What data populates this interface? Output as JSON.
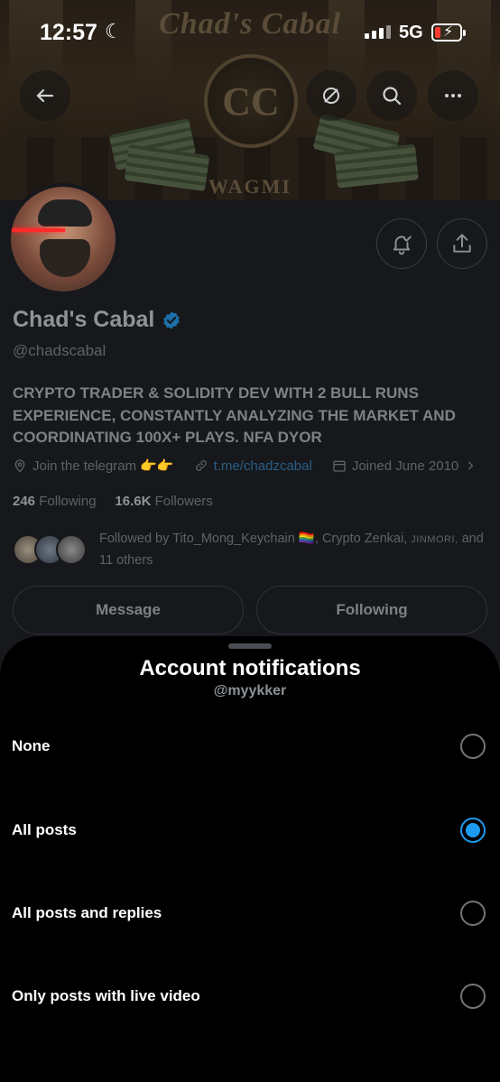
{
  "status_bar": {
    "time": "12:57",
    "network": "5G",
    "moon_icon": "moon-icon",
    "signal_icon": "cellular-signal-icon",
    "battery_icon": "battery-charging-low-icon",
    "battery_color": "#ff3b30"
  },
  "banner": {
    "title": "Chad's Cabal",
    "seal": "CC",
    "tagline": "WAGMI"
  },
  "top_actions": {
    "back_icon": "back-arrow-icon",
    "grok_icon": "slash-circle-icon",
    "search_icon": "search-icon",
    "more_icon": "more-horizontal-icon"
  },
  "profile": {
    "name": "Chad's Cabal",
    "handle": "@chadscabal",
    "verified_color": "#1d9bf0",
    "bio": "CRYPTO TRADER & SOLIDITY DEV WITH 2 BULL RUNS EXPERIENCE, CONSTANTLY ANALYZING THE MARKET AND COORDINATING 100X+ PLAYS. NFA DYOR",
    "location": "Join the telegram 👉👉",
    "website": "t.me/chadzcabal",
    "joined": "Joined June 2010",
    "following_count": "246",
    "following_label": "Following",
    "followers_count": "16.6K",
    "followers_label": "Followers",
    "followed_by_prefix": "Followed by ",
    "followed_by_names": "Tito_Mong_Keychain 🏳️‍🌈, Crypto Zenkai, ",
    "followed_by_smallcaps": "JINMORI,",
    "followed_by_suffix": " and 11 others",
    "notify_icon": "bell-check-icon",
    "share_icon": "share-icon",
    "message_label": "Message",
    "following_button_label": "Following"
  },
  "sheet": {
    "title": "Account notifications",
    "subtitle": "@myykker",
    "accent_color": "#1d9bf0",
    "options": [
      {
        "label": "None",
        "selected": false
      },
      {
        "label": "All posts",
        "selected": true
      },
      {
        "label": "All posts and replies",
        "selected": false
      },
      {
        "label": "Only posts with live video",
        "selected": false
      }
    ]
  }
}
